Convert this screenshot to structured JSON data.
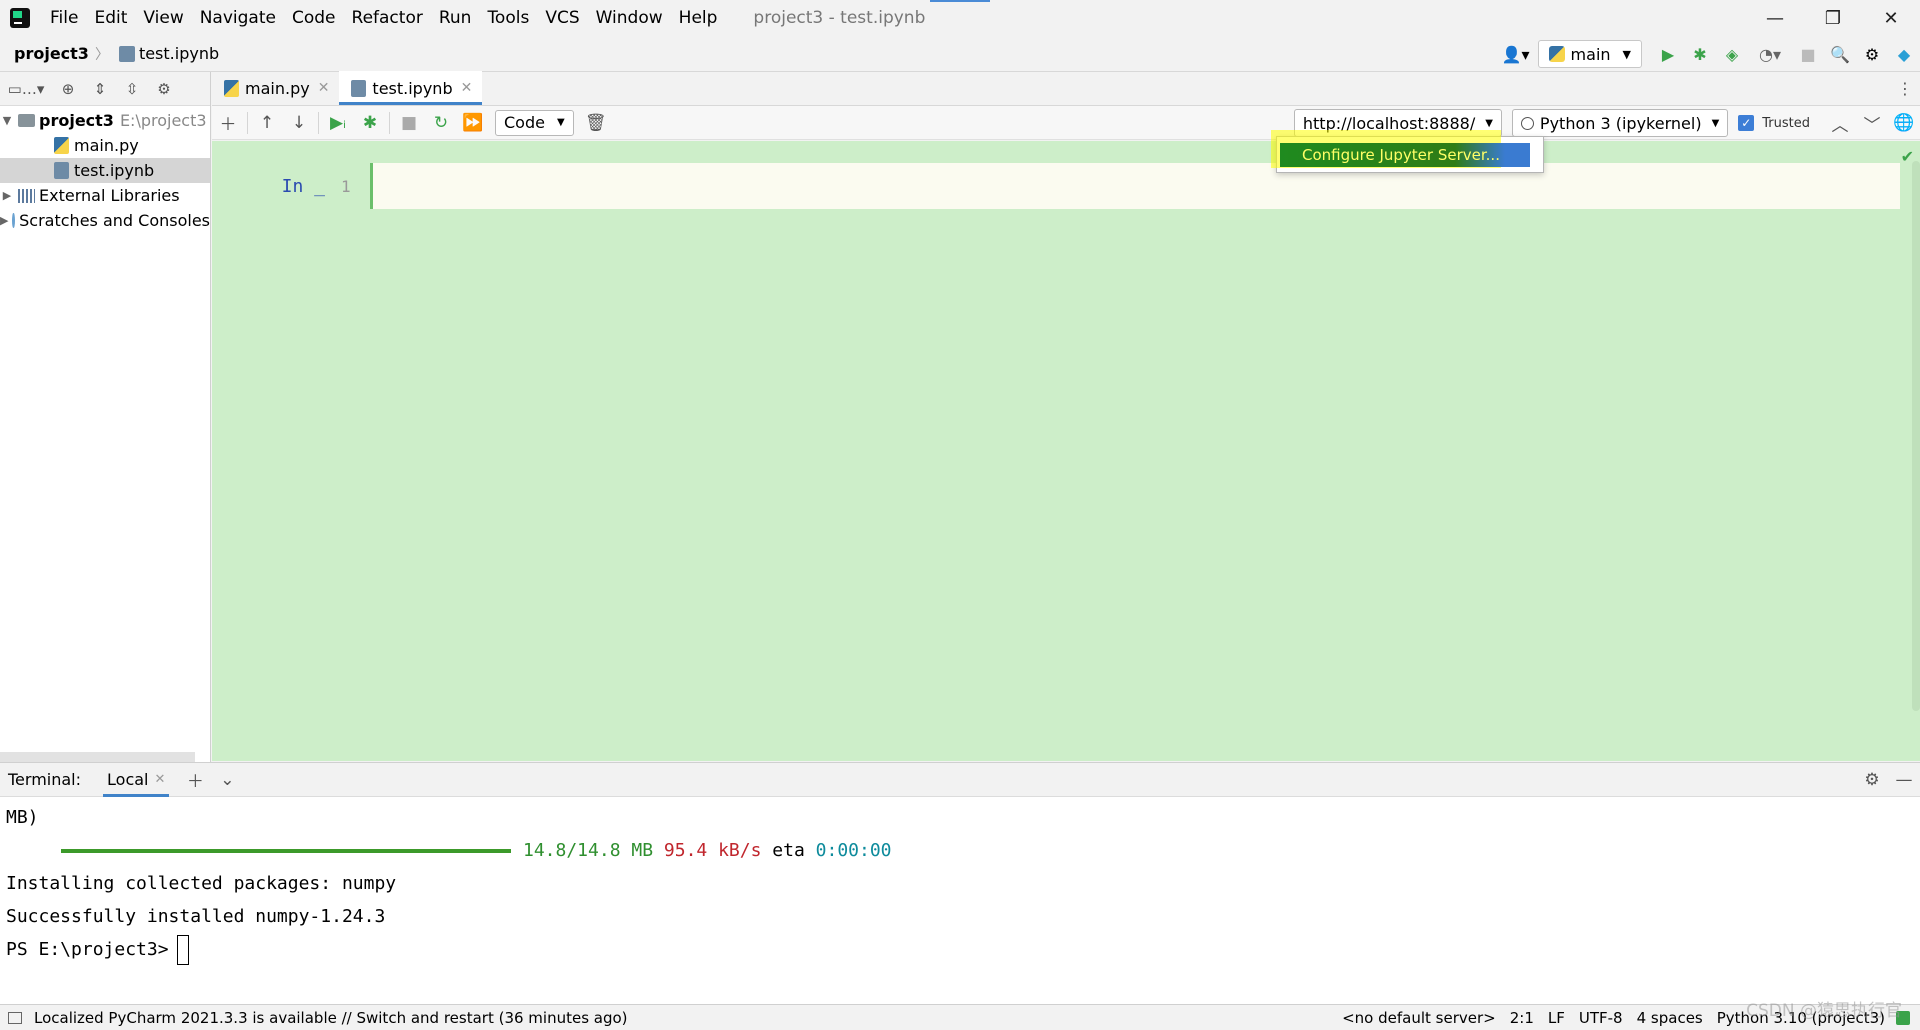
{
  "menu": [
    "File",
    "Edit",
    "View",
    "Navigate",
    "Code",
    "Refactor",
    "Run",
    "Tools",
    "VCS",
    "Window",
    "Help"
  ],
  "window_title": "project3 - test.ipynb",
  "breadcrumb": {
    "project": "project3",
    "file": "test.ipynb"
  },
  "run_config": "main",
  "project_tree": {
    "root_name": "project3",
    "root_path": "E:\\project3",
    "files": [
      "main.py",
      "test.ipynb"
    ],
    "external_libraries": "External Libraries",
    "scratches": "Scratches and Consoles"
  },
  "tabs": [
    {
      "label": "main.py"
    },
    {
      "label": "test.ipynb"
    }
  ],
  "notebook_toolbar": {
    "cell_type": "Code",
    "server": "http://localhost:8888/",
    "kernel": "Python 3 (ipykernel)",
    "trusted_label": "Trusted"
  },
  "cell": {
    "prompt": "In _",
    "line_number": "1"
  },
  "server_dropdown": {
    "item": "Configure Jupyter Server..."
  },
  "terminal": {
    "label": "Terminal:",
    "tab": "Local",
    "lines": {
      "l1": "MB)",
      "progress_size": "14.8/14.8 MB",
      "progress_speed": "95.4 kB/s",
      "progress_eta_label": "eta",
      "progress_eta": "0:00:00",
      "l3": "Installing collected packages: numpy",
      "l4": "Successfully installed numpy-1.24.3",
      "prompt": "PS E:\\project3>"
    }
  },
  "statusbar": {
    "message": "Localized PyCharm 2021.3.3 is available // Switch and restart (36 minutes ago)",
    "server": "<no default server>",
    "position": "2:1",
    "line_sep": "LF",
    "encoding": "UTF-8",
    "indent": "4 spaces",
    "interpreter": "Python 3.10 (project3)"
  },
  "watermark": "CSDN @猿思执行官",
  "colors": {
    "notebook_bg": "#cdeec9",
    "accent": "#4083c9",
    "run_green": "#3ba34a"
  }
}
